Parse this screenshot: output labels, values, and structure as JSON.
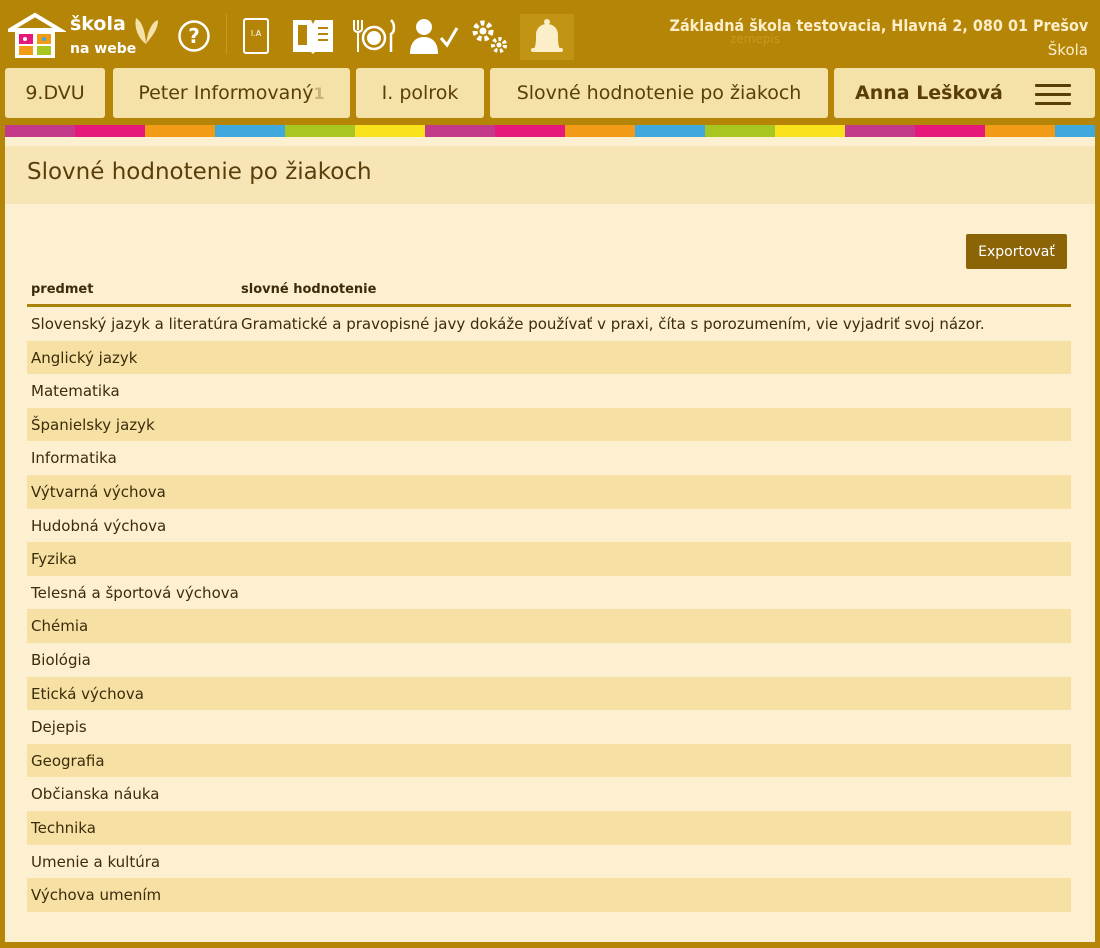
{
  "header": {
    "logo_line1": "škola",
    "logo_line2": "na webe",
    "school_name": "Základná škola testovacia, Hlavná 2, 080 01 Prešov",
    "role": "Škola",
    "class_book_label": "I.A",
    "icons": [
      "help-icon",
      "class-book-icon",
      "info-book-icon",
      "dining-icon",
      "teacher-check-icon",
      "settings-gears-icon",
      "notification-bell-icon"
    ],
    "watermark_text": "zemepis"
  },
  "nav": {
    "class": "9.DVU",
    "teacher": "Peter Informovaný",
    "teacher_count": "1",
    "term": "I. polrok",
    "section": "Slovné hodnotenie po žiakoch",
    "student": "Anna Lešková"
  },
  "stripe_colors": [
    "#c43a8a",
    "#e6197a",
    "#f29b16",
    "#3fa9de",
    "#a7c61f",
    "#f9e21b"
  ],
  "page": {
    "title": "Slovné hodnotenie po žiakoch",
    "export_label": "Exportovať"
  },
  "table": {
    "col_subject": "predmet",
    "col_evaluation": "slovné hodnotenie",
    "rows": [
      {
        "subject": "Slovenský jazyk a literatúra",
        "evaluation": "Gramatické a pravopisné javy dokáže používať v praxi, číta s porozumením, vie vyjadriť svoj názor."
      },
      {
        "subject": "Anglický jazyk",
        "evaluation": ""
      },
      {
        "subject": "Matematika",
        "evaluation": ""
      },
      {
        "subject": "Španielsky jazyk",
        "evaluation": ""
      },
      {
        "subject": "Informatika",
        "evaluation": ""
      },
      {
        "subject": "Výtvarná výchova",
        "evaluation": ""
      },
      {
        "subject": "Hudobná výchova",
        "evaluation": ""
      },
      {
        "subject": "Fyzika",
        "evaluation": ""
      },
      {
        "subject": "Telesná a športová výchova",
        "evaluation": ""
      },
      {
        "subject": "Chémia",
        "evaluation": ""
      },
      {
        "subject": "Biológia",
        "evaluation": ""
      },
      {
        "subject": "Etická výchova",
        "evaluation": ""
      },
      {
        "subject": "Dejepis",
        "evaluation": ""
      },
      {
        "subject": "Geografia",
        "evaluation": ""
      },
      {
        "subject": "Občianska náuka",
        "evaluation": ""
      },
      {
        "subject": "Technika",
        "evaluation": ""
      },
      {
        "subject": "Umenie a kultúra",
        "evaluation": ""
      },
      {
        "subject": "Výchova umením",
        "evaluation": ""
      }
    ]
  }
}
